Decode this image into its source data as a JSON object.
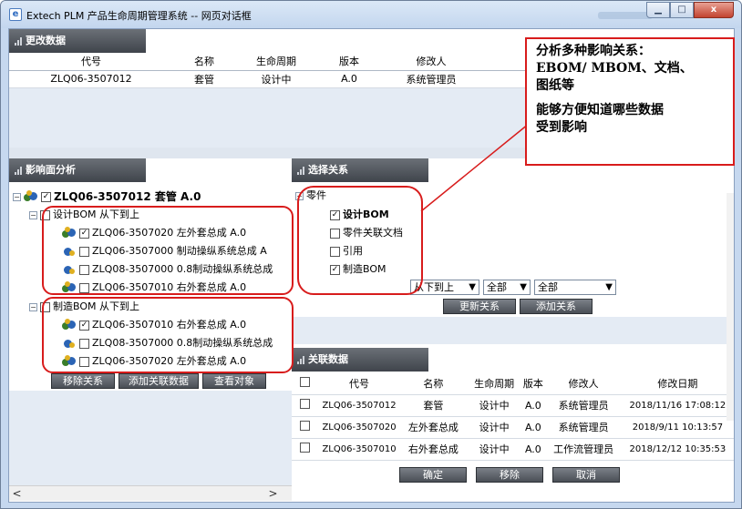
{
  "window": {
    "title": "Extech PLM 产品生命周期管理系统 -- 网页对话框",
    "minimize": "▁",
    "maximize": "□",
    "close": "x"
  },
  "change_data": {
    "title": "更改数据",
    "columns": [
      "代号",
      "名称",
      "生命周期",
      "版本",
      "修改人"
    ],
    "rows": [
      [
        "ZLQ06-3507012",
        "套管",
        "设计中",
        "A.0",
        "系统管理员"
      ]
    ]
  },
  "impact": {
    "title": "影响面分析",
    "root": "ZLQ06-3507012 套管  A.0",
    "groups": [
      {
        "label": "设计BOM 从下到上",
        "items": [
          {
            "text": "ZLQ06-3507020 左外套总成  A.0",
            "checked": true
          },
          {
            "text": "ZLQ06-3507000 制动操纵系统总成  A",
            "checked": false
          },
          {
            "text": "ZLQ08-3507000 0.8制动操纵系统总成",
            "checked": false
          },
          {
            "text": "ZLQ06-3507010 右外套总成  A.0",
            "checked": false
          }
        ]
      },
      {
        "label": "制造BOM 从下到上",
        "items": [
          {
            "text": "ZLQ06-3507010 右外套总成  A.0",
            "checked": true
          },
          {
            "text": "ZLQ08-3507000 0.8制动操纵系统总成",
            "checked": false
          },
          {
            "text": "ZLQ06-3507020 左外套总成  A.0",
            "checked": false
          }
        ]
      }
    ],
    "buttons": [
      "移除关系",
      "添加关联数据",
      "查看对象"
    ]
  },
  "select_relation": {
    "title": "选择关系",
    "root": "零件",
    "options": [
      {
        "label": "设计BOM",
        "checked": true
      },
      {
        "label": "零件关联文档",
        "checked": false
      },
      {
        "label": "引用",
        "checked": false
      },
      {
        "label": "制造BOM",
        "checked": true
      }
    ],
    "direction": "从下到上",
    "scope1": "全部",
    "scope2": "全部",
    "buttons": [
      "更新关系",
      "添加关系"
    ]
  },
  "related_data": {
    "title": "关联数据",
    "columns": [
      "代号",
      "名称",
      "生命周期",
      "版本",
      "修改人",
      "修改日期"
    ],
    "rows": [
      [
        "ZLQ06-3507012",
        "套管",
        "设计中",
        "A.0",
        "系统管理员",
        "2018/11/16 17:08:12"
      ],
      [
        "ZLQ06-3507020",
        "左外套总成",
        "设计中",
        "A.0",
        "系统管理员",
        "2018/9/11 10:13:57"
      ],
      [
        "ZLQ06-3507010",
        "右外套总成",
        "设计中",
        "A.0",
        "工作流管理员",
        "2018/12/12 10:35:53"
      ]
    ],
    "buttons": [
      "确定",
      "移除",
      "取消"
    ]
  },
  "callout": {
    "line1": "分析多种影响关系：",
    "line2": "EBOM/ MBOM、文档、",
    "line3": "图纸等",
    "line4": "能够方便知道哪些数据",
    "line5": "受到影响"
  },
  "scroll": {
    "left": "<",
    "right": ">"
  }
}
